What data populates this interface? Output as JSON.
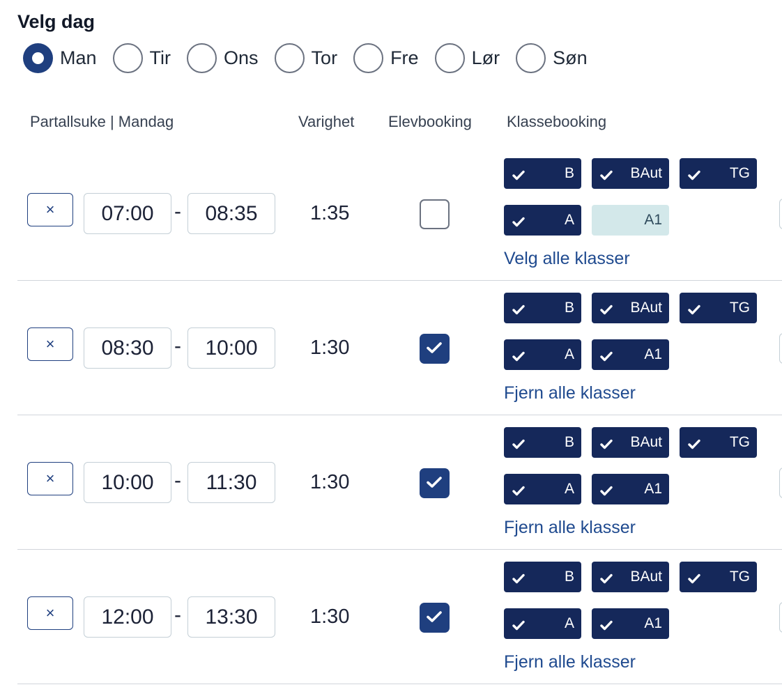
{
  "title": "Velg dag",
  "days": [
    {
      "label": "Man",
      "selected": true
    },
    {
      "label": "Tir",
      "selected": false
    },
    {
      "label": "Ons",
      "selected": false
    },
    {
      "label": "Tor",
      "selected": false
    },
    {
      "label": "Fre",
      "selected": false
    },
    {
      "label": "Lør",
      "selected": false
    },
    {
      "label": "Søn",
      "selected": false
    }
  ],
  "headers": {
    "period": "Partallsuke | Mandag",
    "duration": "Varighet",
    "student_booking": "Elevbooking",
    "class_booking": "Klassebooking"
  },
  "remove_icon": "×",
  "time_separator": "-",
  "rows": [
    {
      "from": "07:00",
      "to": "08:35",
      "duration": "1:35",
      "student_booking": false,
      "classes": [
        {
          "label": "B",
          "selected": true
        },
        {
          "label": "BAut",
          "selected": true
        },
        {
          "label": "TG",
          "selected": true
        },
        {
          "label": "A",
          "selected": true
        },
        {
          "label": "A1",
          "selected": false
        }
      ],
      "action": "Velg alle klasser"
    },
    {
      "from": "08:30",
      "to": "10:00",
      "duration": "1:30",
      "student_booking": true,
      "classes": [
        {
          "label": "B",
          "selected": true
        },
        {
          "label": "BAut",
          "selected": true
        },
        {
          "label": "TG",
          "selected": true
        },
        {
          "label": "A",
          "selected": true
        },
        {
          "label": "A1",
          "selected": true
        }
      ],
      "action": "Fjern alle klasser"
    },
    {
      "from": "10:00",
      "to": "11:30",
      "duration": "1:30",
      "student_booking": true,
      "classes": [
        {
          "label": "B",
          "selected": true
        },
        {
          "label": "BAut",
          "selected": true
        },
        {
          "label": "TG",
          "selected": true
        },
        {
          "label": "A",
          "selected": true
        },
        {
          "label": "A1",
          "selected": true
        }
      ],
      "action": "Fjern alle klasser"
    },
    {
      "from": "12:00",
      "to": "13:30",
      "duration": "1:30",
      "student_booking": true,
      "classes": [
        {
          "label": "B",
          "selected": true
        },
        {
          "label": "BAut",
          "selected": true
        },
        {
          "label": "TG",
          "selected": true
        },
        {
          "label": "A",
          "selected": true
        },
        {
          "label": "A1",
          "selected": true
        }
      ],
      "action": "Fjern alle klasser"
    }
  ],
  "colors": {
    "primary": "#1f3f7f",
    "chip_selected": "#15285a",
    "chip_unselected": "#d3e8ea",
    "link": "#1f4a8f"
  }
}
